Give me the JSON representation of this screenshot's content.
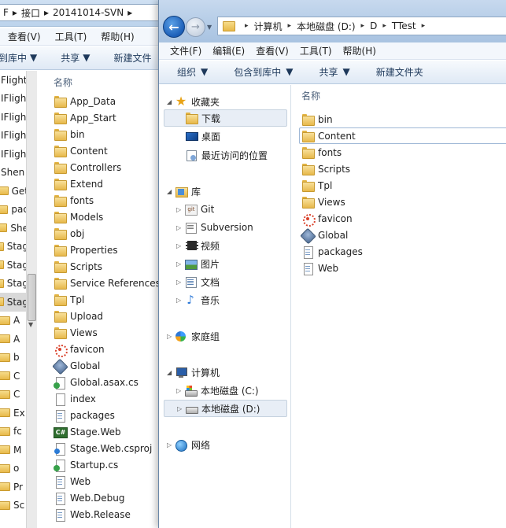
{
  "back_window": {
    "breadcrumb": [
      "F",
      "接口",
      "20141014-SVN"
    ],
    "menu": [
      "查看(V)",
      "工具(T)",
      "帮助(H)"
    ],
    "toolbar": [
      "到库中",
      "共享",
      "新建文件"
    ],
    "nav_items": [
      "Flight",
      "IFligh",
      "IFligh",
      "IFligh",
      "IFligh",
      "Shen",
      "Get",
      "pac",
      "She",
      "Stag",
      "Stag",
      "Stag",
      "Stag",
      "A",
      "A",
      "b",
      "C",
      "C",
      "Ex",
      "fc",
      "M",
      "o",
      "Pr",
      "Sc"
    ],
    "column_header": "名称",
    "files": [
      {
        "name": "App_Data",
        "icon": "folder-icon"
      },
      {
        "name": "App_Start",
        "icon": "folder-icon"
      },
      {
        "name": "bin",
        "icon": "folder-icon"
      },
      {
        "name": "Content",
        "icon": "folder-icon"
      },
      {
        "name": "Controllers",
        "icon": "folder-icon"
      },
      {
        "name": "Extend",
        "icon": "folder-icon"
      },
      {
        "name": "fonts",
        "icon": "folder-icon"
      },
      {
        "name": "Models",
        "icon": "folder-icon"
      },
      {
        "name": "obj",
        "icon": "folder-icon"
      },
      {
        "name": "Properties",
        "icon": "folder-icon"
      },
      {
        "name": "Scripts",
        "icon": "folder-icon"
      },
      {
        "name": "Service References",
        "icon": "folder-icon"
      },
      {
        "name": "Tpl",
        "icon": "folder-icon"
      },
      {
        "name": "Upload",
        "icon": "folder-icon"
      },
      {
        "name": "Views",
        "icon": "folder-icon"
      },
      {
        "name": "favicon",
        "icon": "favicon-icon"
      },
      {
        "name": "Global",
        "icon": "global-icon"
      },
      {
        "name": "Global.asax.cs",
        "icon": "gear-file-icon"
      },
      {
        "name": "index",
        "icon": "file-icon"
      },
      {
        "name": "packages",
        "icon": "config-file-icon"
      },
      {
        "name": "Stage.Web",
        "icon": "csharp-icon"
      },
      {
        "name": "Stage.Web.csproj",
        "icon": "project-file-icon"
      },
      {
        "name": "Startup.cs",
        "icon": "gear-file-icon"
      },
      {
        "name": "Web",
        "icon": "config-file-icon"
      },
      {
        "name": "Web.Debug",
        "icon": "config-file-icon"
      },
      {
        "name": "Web.Release",
        "icon": "config-file-icon"
      }
    ]
  },
  "front_window": {
    "address": [
      "计算机",
      "本地磁盘 (D:)",
      "D",
      "TTest"
    ],
    "menu": [
      "文件(F)",
      "编辑(E)",
      "查看(V)",
      "工具(T)",
      "帮助(H)"
    ],
    "toolbar": [
      "组织",
      "包含到库中",
      "共享",
      "新建文件夹"
    ],
    "nav": {
      "favorites": {
        "label": "收藏夹",
        "items": [
          "下载",
          "桌面",
          "最近访问的位置"
        ]
      },
      "libraries": {
        "label": "库",
        "items": [
          "Git",
          "Subversion",
          "视频",
          "图片",
          "文档",
          "音乐"
        ]
      },
      "homegroup": "家庭组",
      "computer": {
        "label": "计算机",
        "items": [
          "本地磁盘 (C:)",
          "本地磁盘 (D:)"
        ]
      },
      "network": "网络"
    },
    "column_header": "名称",
    "files": [
      {
        "name": "bin",
        "icon": "folder-icon"
      },
      {
        "name": "Content",
        "icon": "folder-icon"
      },
      {
        "name": "fonts",
        "icon": "folder-icon"
      },
      {
        "name": "Scripts",
        "icon": "folder-icon"
      },
      {
        "name": "Tpl",
        "icon": "folder-icon"
      },
      {
        "name": "Views",
        "icon": "folder-icon"
      },
      {
        "name": "favicon",
        "icon": "favicon-icon"
      },
      {
        "name": "Global",
        "icon": "global-icon"
      },
      {
        "name": "packages",
        "icon": "config-file-icon"
      },
      {
        "name": "Web",
        "icon": "config-file-icon"
      }
    ]
  }
}
